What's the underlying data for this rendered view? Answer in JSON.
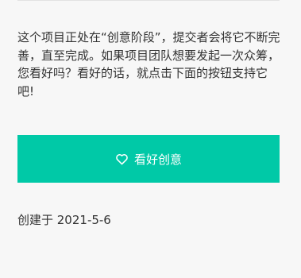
{
  "project": {
    "description": "这个项目正处在“创意阶段”，提交者会将它不断完善，直至完成。如果项目团队想要发起一次众筹，您看好吗？看好的话，就点击下面的按钮支持它吧!",
    "like_button_label": "看好创意",
    "like_icon": "heart-outline-icon",
    "created_label": "创建于 2021-5-6"
  },
  "colors": {
    "accent": "#00c9a7",
    "background": "#f7f7f7",
    "text": "#333333"
  }
}
